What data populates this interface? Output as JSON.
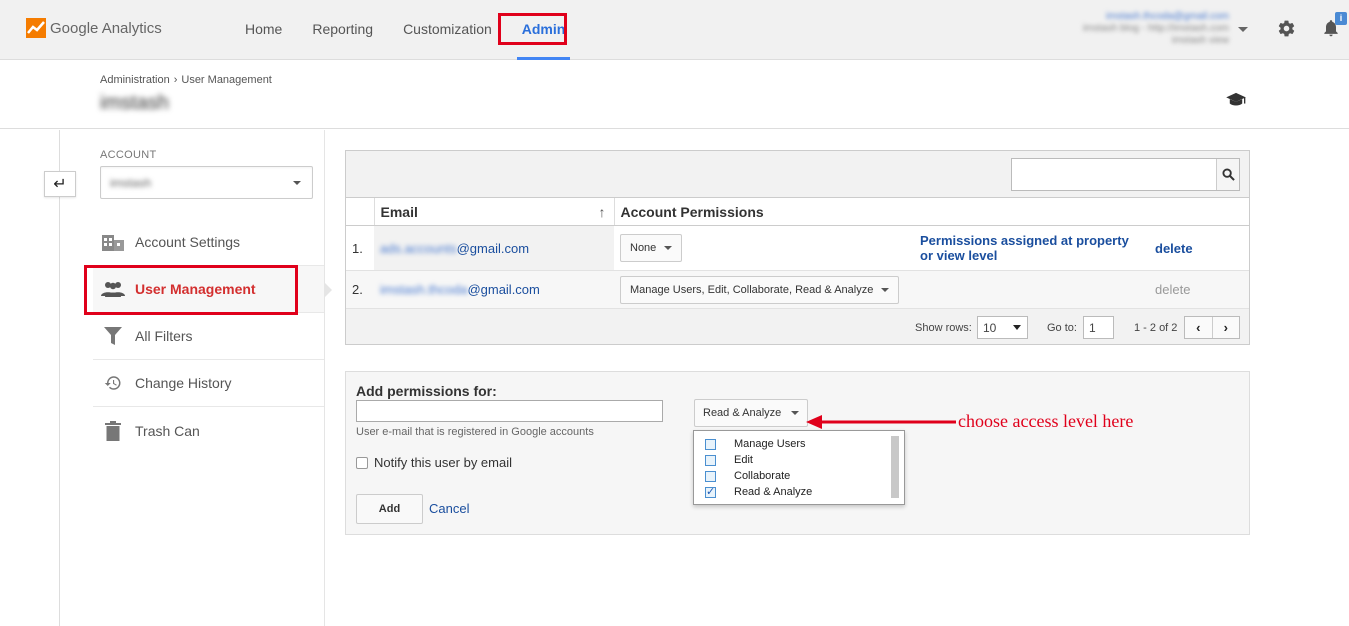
{
  "app": {
    "name": "Google Analytics",
    "accent": "#f57c00"
  },
  "nav": {
    "items": [
      "Home",
      "Reporting",
      "Customization",
      "Admin"
    ],
    "active": "Admin"
  },
  "account_header": {
    "email": "imstash.thcoda@gmail.com",
    "line2": "imstash blog - http://imstash.com",
    "line3": "imstash view"
  },
  "breadcrumb": {
    "root": "Administration",
    "separator": "›",
    "current": "User Management"
  },
  "page_title": "imstash",
  "sidebar": {
    "account_label": "ACCOUNT",
    "account_value": "imstash",
    "items": [
      {
        "label": "Account Settings",
        "icon": "building-icon"
      },
      {
        "label": "User Management",
        "icon": "users-icon",
        "active": true
      },
      {
        "label": "All Filters",
        "icon": "filter-icon"
      },
      {
        "label": "Change History",
        "icon": "history-icon"
      },
      {
        "label": "Trash Can",
        "icon": "trash-icon"
      }
    ]
  },
  "table": {
    "headers": {
      "email": "Email",
      "permissions": "Account Permissions"
    },
    "rows": [
      {
        "num": "1.",
        "email_user": "ads.accounts",
        "email_domain": "@gmail.com",
        "permission": "None",
        "note": "Permissions assigned at property or view level",
        "action": "delete"
      },
      {
        "num": "2.",
        "email_user": "imstash.thcoda",
        "email_domain": "@gmail.com",
        "permission": "Manage Users, Edit, Collaborate, Read & Analyze",
        "note": "",
        "action": "delete"
      }
    ],
    "pager": {
      "show_rows_label": "Show rows:",
      "rows": "10",
      "goto_label": "Go to:",
      "goto": "1",
      "range": "1 - 2 of 2"
    }
  },
  "add_permissions": {
    "title": "Add permissions for:",
    "input_value": "",
    "hint": "User e-mail that is registered in Google accounts",
    "notify_label": "Notify this user by email",
    "add_label": "Add",
    "cancel_label": "Cancel",
    "access_selected": "Read & Analyze",
    "options": [
      {
        "label": "Manage Users",
        "checked": false
      },
      {
        "label": "Edit",
        "checked": false
      },
      {
        "label": "Collaborate",
        "checked": false
      },
      {
        "label": "Read & Analyze",
        "checked": true
      }
    ]
  },
  "annotation": {
    "text": "choose access level here",
    "color": "#e0001b"
  },
  "badge": "i"
}
